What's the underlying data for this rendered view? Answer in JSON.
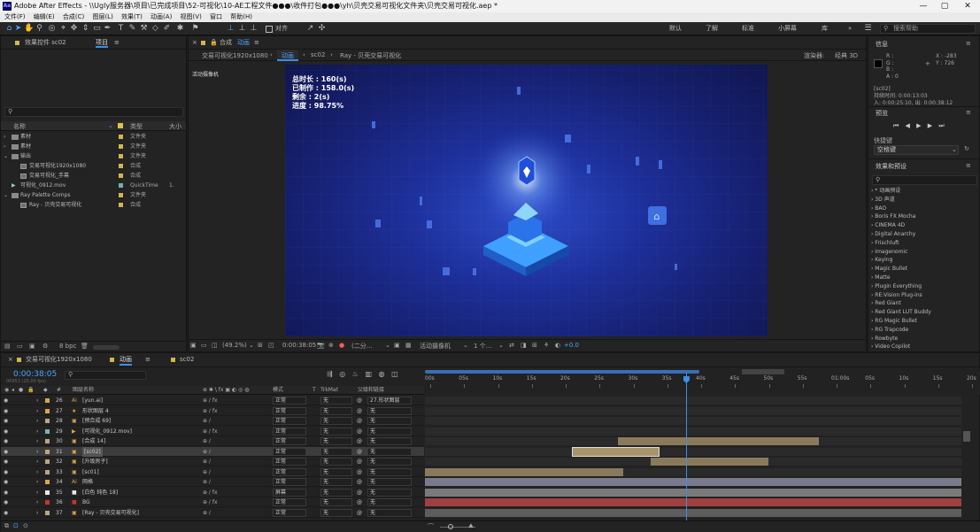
{
  "window": {
    "app_icon": "Ae",
    "title": "Adobe After Effects - \\\\Ugly服务器\\项目\\已完成项目\\52-可视化\\10-AE工程文件●●●\\收件打包●●●\\yh\\贝壳交易可视化文件夹\\贝壳交易可视化.aep *",
    "min": "—",
    "max": "▢",
    "close": "✕"
  },
  "menu": [
    "文件(F)",
    "编辑(E)",
    "合成(C)",
    "图层(L)",
    "效果(T)",
    "动画(A)",
    "视图(V)",
    "窗口",
    "帮助(H)"
  ],
  "toolbar": {
    "snap_label": "对齐",
    "workspaces": [
      "默认",
      "了解",
      "标准",
      "小屏幕",
      "库"
    ],
    "more": "»",
    "search_help": "搜索帮助"
  },
  "project_panel": {
    "tab_effects": "效果控件 sc02",
    "tab_project": "项目",
    "col_name": "名称",
    "col_type": "类型",
    "col_size": "大小",
    "items": [
      {
        "name": "素材",
        "type": "文件夹",
        "kind": "folder",
        "color": "#d1b64d",
        "indent": 0,
        "twirl": "›"
      },
      {
        "name": "素材",
        "type": "文件夹",
        "kind": "folder",
        "color": "#d1b64d",
        "indent": 0,
        "twirl": "›"
      },
      {
        "name": "输出",
        "type": "文件夹",
        "kind": "folder",
        "color": "#d1b64d",
        "indent": 0,
        "twirl": "⌄"
      },
      {
        "name": "交易可视化1920x1080",
        "type": "合成",
        "kind": "comp",
        "color": "#d1b64d",
        "indent": 1,
        "twirl": ""
      },
      {
        "name": "交易可视化_手幕",
        "type": "合成",
        "kind": "comp",
        "color": "#d1b64d",
        "indent": 1,
        "twirl": ""
      },
      {
        "name": "可视化_0912.mov",
        "type": "QuickTime",
        "kind": "video",
        "color": "#6fb0b0",
        "indent": 0,
        "twirl": "",
        "size": "1."
      },
      {
        "name": "Ray Palette Comps",
        "type": "文件夹",
        "kind": "folder",
        "color": "#d1b64d",
        "indent": 0,
        "twirl": "⌄"
      },
      {
        "name": "Ray - 贝壳交易可视化",
        "type": "合成",
        "kind": "comp",
        "color": "#d1b64d",
        "indent": 1,
        "twirl": ""
      }
    ],
    "bpc": "8 bpc"
  },
  "comp_panel": {
    "tab": "合成",
    "tab_name": "动画",
    "breadcrumbs": [
      "交易可视化1920x1080",
      "动画",
      "sc02",
      "Ray - 贝壳交易可视化"
    ],
    "renderer_label": "渲染器:",
    "renderer": "经典 3D",
    "camera_label": "活动摄像机",
    "overlay_lines": [
      "总时长 : 160(s)",
      "已制作 : 158.0(s)",
      "剩余 : 2(s)",
      "进度 : 98.75%"
    ],
    "footer": {
      "zoom": "(49.2%)",
      "timecode": "0:00:38:05",
      "resolution": "(二分…",
      "camera": "活动摄像机",
      "views": "1 个…",
      "exposure": "+0.0"
    }
  },
  "info_panel": {
    "title": "信息",
    "r": "R :",
    "g": "G :",
    "b": "B :",
    "a": "A : 0",
    "x": "X : -283",
    "y": "Y : 726",
    "layer": "[sc02]",
    "duration": "持续时间: 0:00:13:03",
    "in_out": "入: 0:00:25:10, 出: 0:00:38:12"
  },
  "preview_panel": {
    "title": "预览"
  },
  "shortcut_panel": {
    "title": "快捷键",
    "value": "空格键"
  },
  "effects_panel": {
    "title": "效果和预设",
    "items": [
      "* 动画预设",
      "3D 声道",
      "BAO",
      "Boris FX Mocha",
      "CINEMA 4D",
      "Digital Anarchy",
      "Frischluft",
      "Imagenomic",
      "Keying",
      "Magic Bullet",
      "Matte",
      "Plugin Everything",
      "RE:Vision Plug-ins",
      "Red Giant",
      "Red Giant LUT Buddy",
      "RG Magic Bullet",
      "RG Trapcode",
      "Rowbyte",
      "Video Copilot"
    ]
  },
  "timeline": {
    "tabs": [
      "交易可视化1920x1080",
      "动画",
      "sc02"
    ],
    "timecode": "0:00:38:05",
    "frame_info": "00953 (25.00 fps)",
    "headers": {
      "num": "#",
      "name": "图层名称",
      "mode": "模式",
      "t": "T",
      "trkmat": "TrkMat",
      "parent": "父级和链接"
    },
    "ruler": [
      "00s",
      "05s",
      "10s",
      "15s",
      "20s",
      "25s",
      "30s",
      "35s",
      "40s",
      "45s",
      "50s",
      "55s",
      "01:00s",
      "05s",
      "10s",
      "15s",
      "20s"
    ],
    "playhead_fraction": 0.472,
    "layers": [
      {
        "num": "26",
        "name": "[yun.ai]",
        "color": "#d9a64b",
        "icon": "ai",
        "mode": "正常",
        "trk": "无",
        "parent": "27.形状图层",
        "fx": true,
        "sel": false,
        "bar": null
      },
      {
        "num": "27",
        "name": "形状图层 4",
        "color": "#d9a64b",
        "icon": "star",
        "mode": "正常",
        "trk": "无",
        "parent": "无",
        "fx": true,
        "sel": false,
        "bar": null
      },
      {
        "num": "28",
        "name": "[预合成 69]",
        "color": "#b9a77e",
        "icon": "comp",
        "mode": "正常",
        "trk": "无",
        "parent": "无",
        "fx": false,
        "sel": false,
        "bar": null
      },
      {
        "num": "29",
        "name": "[可视化_0912.mov]",
        "color": "#7cb1b1",
        "icon": "video",
        "mode": "正常",
        "trk": "无",
        "parent": "无",
        "fx": true,
        "sel": false,
        "bar": null
      },
      {
        "num": "30",
        "name": "[合成 14]",
        "color": "#b9a77e",
        "icon": "comp",
        "mode": "正常",
        "trk": "无",
        "parent": "无",
        "fx": false,
        "sel": false,
        "bar": {
          "start": 0.36,
          "end": 0.735,
          "color": "#8a7a5c"
        }
      },
      {
        "num": "31",
        "name": "[sc02]",
        "color": "#b9a77e",
        "icon": "comp",
        "mode": "正常",
        "trk": "无",
        "parent": "无",
        "fx": false,
        "sel": true,
        "bar": {
          "start": 0.275,
          "end": 0.435,
          "color": "#a8946c"
        }
      },
      {
        "num": "32",
        "name": "[升级房子]",
        "color": "#b9a77e",
        "icon": "comp",
        "mode": "正常",
        "trk": "无",
        "parent": "无",
        "fx": false,
        "sel": false,
        "bar": {
          "start": 0.42,
          "end": 0.64,
          "color": "#8a7a5c"
        }
      },
      {
        "num": "33",
        "name": "[sc01]",
        "color": "#b9a77e",
        "icon": "comp",
        "mode": "正常",
        "trk": "无",
        "parent": "无",
        "fx": false,
        "sel": false,
        "bar": {
          "start": 0.0,
          "end": 0.37,
          "color": "#8a7a5c"
        }
      },
      {
        "num": "34",
        "name": "网格",
        "color": "#d9a64b",
        "icon": "ai",
        "mode": "正常",
        "trk": "无",
        "parent": "无",
        "fx": false,
        "sel": false,
        "bar": {
          "start": 0.0,
          "end": 1.0,
          "color": "#797a8c"
        }
      },
      {
        "num": "35",
        "name": "[白色 纯色 18]",
        "color": "#e8e8e8",
        "icon": "solid",
        "mode": "屏幕",
        "trk": "无",
        "parent": "无",
        "fx": true,
        "sel": false,
        "bar": {
          "start": 0.0,
          "end": 1.0,
          "color": "#7a7a7a"
        }
      },
      {
        "num": "36",
        "name": "BG",
        "color": "#c0392b",
        "icon": "solid",
        "mode": "正常",
        "trk": "无",
        "parent": "无",
        "fx": true,
        "sel": false,
        "bar": {
          "start": 0.0,
          "end": 1.0,
          "color": "#a04040"
        }
      },
      {
        "num": "37",
        "name": "[Ray - 贝壳交易可视化]",
        "color": "#b9a77e",
        "icon": "comp",
        "mode": "正常",
        "trk": "无",
        "parent": "无",
        "fx": false,
        "sel": false,
        "bar": {
          "start": 0.0,
          "end": 1.0,
          "color": "#5d5d5d"
        }
      }
    ]
  }
}
